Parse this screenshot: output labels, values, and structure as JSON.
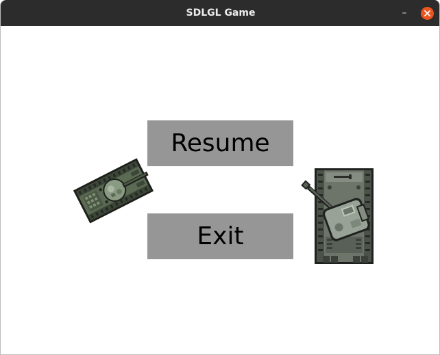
{
  "window": {
    "title": "SDLGL Game",
    "minimize_glyph": "–",
    "close_icon": "close-icon"
  },
  "menu": {
    "resume_label": "Resume",
    "exit_label": "Exit"
  },
  "sprites": {
    "left": "tank-sprite",
    "right": "tank-sprite"
  },
  "colors": {
    "titlebar": "#2c2c2c",
    "close": "#e95420",
    "button": "#969696",
    "background": "#ffffff",
    "tank_green": "#5c6b55",
    "tank_gray": "#6e756c"
  }
}
